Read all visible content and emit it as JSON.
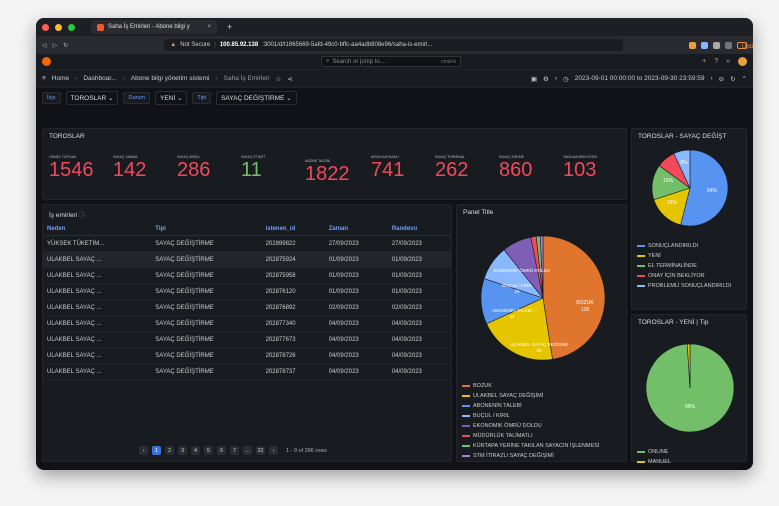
{
  "browser": {
    "tab_title": "Saha İş Emirleri - Abone bilgi y",
    "url_prefix": "Not Secure",
    "url_host": "100.85.92.138",
    "url_path": ":3001/d/t1865669-5afd-49c0-bffc-aa4adb808e96/saha-is-emirl...",
    "update_label": "Update"
  },
  "grafana": {
    "search_placeholder": "Search or jump to...",
    "search_shortcut": "cmd+k"
  },
  "breadcrumb": {
    "home": "Home",
    "dashboards": "Dashboar...",
    "folder": "Abone bilgi yönetim sistemi",
    "current": "Saha İş Emirleri"
  },
  "timerange": "2023-09-01 00:00:00 to 2023-09-30 23:59:59",
  "variables": [
    {
      "label": "İlçe",
      "value": "TOROSLAR"
    },
    {
      "label": "Durum",
      "value": "YENİ"
    },
    {
      "label": "Tipi",
      "value": "SAYAÇ DEĞİŞTİRME"
    }
  ],
  "stats_panel": {
    "title": "TOROSLAR",
    "items": [
      {
        "label": "GENEL TOPLAM",
        "value": "1546",
        "color": "#f2495c"
      },
      {
        "label": "SAYAÇ YANMA",
        "value": "142",
        "color": "#f2495c"
      },
      {
        "label": "SAYAÇ ARIZA",
        "value": "286",
        "color": "#f2495c"
      },
      {
        "label": "SAYAÇ ETİKET",
        "value": "11",
        "color": "#73bf69"
      },
      {
        "label": "ABONE TALEBİ",
        "value": "1822",
        "color": "#f2495c"
      },
      {
        "label": "ARIZA KAYNAKLI",
        "value": "741",
        "color": "#f2495c"
      },
      {
        "label": "SAYAÇ TERMİNAL",
        "value": "262",
        "color": "#f2495c"
      },
      {
        "label": "SAYAÇ SÖKME",
        "value": "860",
        "color": "#f2495c"
      },
      {
        "label": "TAKILMA BEKLEYEN",
        "value": "103",
        "color": "#f2495c"
      }
    ]
  },
  "table_panel": {
    "title": "İş emirleri",
    "columns": [
      "Neden",
      "Tipi",
      "istenen_id",
      "Zaman",
      "Randevu"
    ],
    "rows": [
      [
        "YÜKSEK TÜKETİM...",
        "SAYAÇ DEĞİŞTİRME",
        "202899822",
        "27/09/2023",
        "27/09/2023"
      ],
      [
        "ULAKBEL SAYAÇ ...",
        "SAYAÇ DEĞİŞTİRME",
        "202875924",
        "01/09/2023",
        "01/09/2023"
      ],
      [
        "ULAKBEL SAYAÇ ...",
        "SAYAÇ DEĞİŞTİRME",
        "202875958",
        "01/09/2023",
        "01/09/2023"
      ],
      [
        "ULAKBEL SAYAÇ ...",
        "SAYAÇ DEĞİŞTİRME",
        "202876120",
        "01/09/2023",
        "01/09/2023"
      ],
      [
        "ULAKBEL SAYAÇ ...",
        "SAYAÇ DEĞİŞTİRME",
        "202876892",
        "02/09/2023",
        "02/09/2023"
      ],
      [
        "ULAKBEL SAYAÇ ...",
        "SAYAÇ DEĞİŞTİRME",
        "202877340",
        "04/09/2023",
        "04/09/2023"
      ],
      [
        "ULAKBEL SAYAÇ ...",
        "SAYAÇ DEĞİŞTİRME",
        "202877673",
        "04/09/2023",
        "04/09/2023"
      ],
      [
        "ULAKBEL SAYAÇ ...",
        "SAYAÇ DEĞİŞTİRME",
        "202878726",
        "04/09/2023",
        "04/09/2023"
      ],
      [
        "ULAKBEL SAYAÇ ...",
        "SAYAÇ DEĞİŞTİRME",
        "202878737",
        "04/09/2023",
        "04/09/2023"
      ]
    ],
    "pages": [
      "1",
      "2",
      "3",
      "4",
      "5",
      "6",
      "7",
      "...",
      "32"
    ],
    "rows_info": "1 - 9 of 286 rows"
  },
  "chart_data": [
    {
      "type": "pie",
      "title": "Panel Title",
      "slice_labels": [
        {
          "text": "EKONOMİK ÖMRÜ DOLDU",
          "value": ""
        },
        {
          "text": "BUÇUL / KIRIL",
          "value": "26"
        },
        {
          "text": "ABONENİN TALEBİ",
          "value": "34"
        },
        {
          "text": "ULAKBEL SAYAÇ DEĞİŞİMİ",
          "value": "59"
        },
        {
          "text": "BOZUK",
          "value": "136"
        }
      ],
      "series": [
        {
          "name": "BOZUK",
          "value": 136,
          "color": "#e0752d"
        },
        {
          "name": "ULAKBEL SAYAÇ DEĞİŞİMİ",
          "value": 59,
          "color": "#e5c400"
        },
        {
          "name": "ABONENİN TALEBİ",
          "value": 34,
          "color": "#5794f2"
        },
        {
          "name": "BUÇUL / KIRIL",
          "value": 26,
          "color": "#8ab8ff"
        },
        {
          "name": "EKONOMİK ÖMRÜ DOLDU",
          "value": 22,
          "color": "#7e5fb5"
        },
        {
          "name": "MÜDÜRLÜK TALİMATLI",
          "value": 4,
          "color": "#f2495c"
        },
        {
          "name": "KÜRTAPA YERİNE TAKILAN SAYACIN İŞLENMESİ",
          "value": 3,
          "color": "#73bf69"
        },
        {
          "name": "STM İTİRAZLI SAYAÇ DEĞİŞİMİ",
          "value": 2,
          "color": "#b877d9"
        }
      ]
    },
    {
      "type": "pie",
      "title": "TOROSLAR - SAYAÇ DEĞİŞT",
      "slice_labels": [
        "54%",
        "15%",
        "16%",
        "8%"
      ],
      "series": [
        {
          "name": "SONUÇLANDIRILDI",
          "value": 54,
          "color": "#5794f2"
        },
        {
          "name": "YENİ",
          "value": 16,
          "color": "#e5c400"
        },
        {
          "name": "EL TERMİNALİNDE",
          "value": 15,
          "color": "#73bf69"
        },
        {
          "name": "ONAY İÇİN BEKLİYOR",
          "value": 8,
          "color": "#f2495c"
        },
        {
          "name": "PROBLEMLİ SONUÇLANDIRILDI",
          "value": 7,
          "color": "#8ab8ff"
        }
      ]
    },
    {
      "type": "pie",
      "title": "TOROSLAR - YENİ | Tip",
      "slice_labels": [
        "99%"
      ],
      "series": [
        {
          "name": "ONLINE",
          "value": 99,
          "color": "#73bf69"
        },
        {
          "name": "MANUEL",
          "value": 1,
          "color": "#e5c400"
        }
      ]
    }
  ]
}
